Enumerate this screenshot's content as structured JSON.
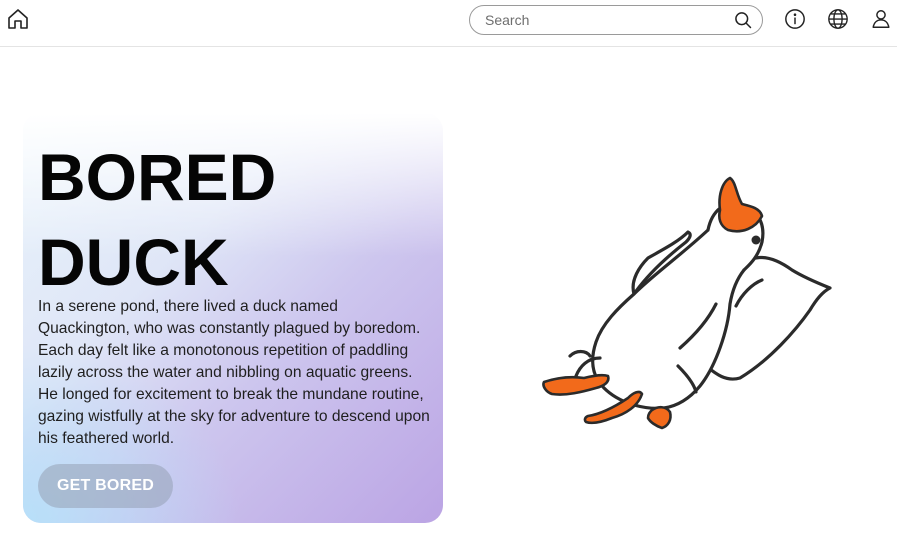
{
  "header": {
    "search": {
      "placeholder": "Search",
      "value": ""
    },
    "icons": [
      "home-icon",
      "search-icon",
      "info-icon",
      "globe-icon",
      "user-icon"
    ]
  },
  "hero": {
    "title_line1": "BORED",
    "title_line2": "DUCK",
    "description": "In a serene pond, there lived a duck named Quackington, who was constantly plagued by boredom. Each day felt like a monotonous repetition of paddling lazily across the water and nibbling on aquatic greens. He longed for excitement to break the mundane routine, gazing wistfully at the sky for adventure to descend upon his feathered world.",
    "cta_label": "GET BORED"
  },
  "illustration": {
    "subject": "duck-lying-on-pillow",
    "colors": {
      "beak_feet": "#f26a1b",
      "outline": "#2b2b2b",
      "body": "#ffffff"
    }
  }
}
